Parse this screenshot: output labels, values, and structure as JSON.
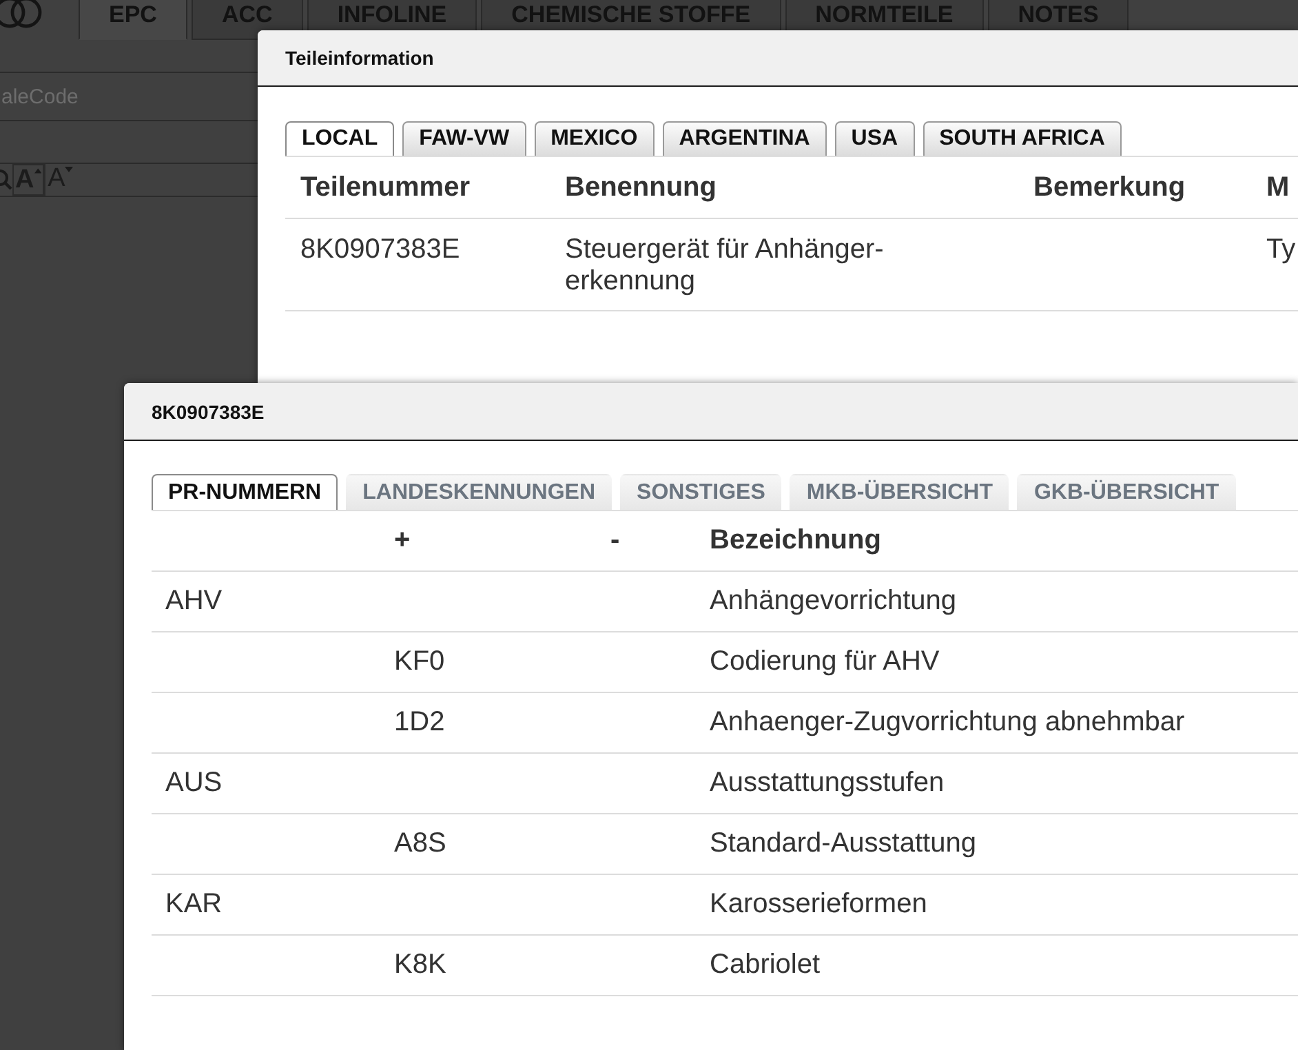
{
  "app_tabs": [
    {
      "label": "EPC",
      "selected": true
    },
    {
      "label": "ACC",
      "selected": false
    },
    {
      "label": "INFOLINE",
      "selected": false
    },
    {
      "label": "CHEMISCHE STOFFE",
      "selected": false
    },
    {
      "label": "NORMTEILE",
      "selected": false
    },
    {
      "label": "NOTES",
      "selected": false
    }
  ],
  "side_panel": {
    "code_field": {
      "placeholder": "aleCode"
    },
    "font_buttons": [
      {
        "kind": "increase",
        "glyph": "A"
      },
      {
        "kind": "decrease",
        "glyph": "A"
      }
    ]
  },
  "parts_dialog": {
    "title": "Teileinformation",
    "tabs": [
      {
        "label": "LOCAL",
        "selected": true
      },
      {
        "label": "FAW-VW",
        "selected": false
      },
      {
        "label": "MEXICO",
        "selected": false
      },
      {
        "label": "ARGENTINA",
        "selected": false
      },
      {
        "label": "USA",
        "selected": false
      },
      {
        "label": "SOUTH AFRICA",
        "selected": false
      }
    ],
    "table": {
      "columns": [
        "Teilenummer",
        "Benennung",
        "Bemerkung",
        "M"
      ],
      "rows": [
        [
          "8K0907383E",
          "Steuergerät für Anhänger-erkennung",
          null,
          "Ty"
        ]
      ]
    }
  },
  "pr_dialog": {
    "title": "8K0907383E",
    "tabs": [
      {
        "label": "PR-NUMMERN",
        "selected": true
      },
      {
        "label": "LANDESKENNUNGEN",
        "selected": false
      },
      {
        "label": "SONSTIGES",
        "selected": false
      },
      {
        "label": "MKB-ÜBERSICHT",
        "selected": false
      },
      {
        "label": "GKB-ÜBERSICHT",
        "selected": false
      }
    ],
    "table": {
      "columns": [
        null,
        "+",
        "-",
        "Bezeichnung"
      ],
      "rows": [
        [
          "AHV",
          null,
          null,
          "Anhängevorrichtung"
        ],
        [
          null,
          "KF0",
          null,
          "Codierung für AHV"
        ],
        [
          null,
          "1D2",
          null,
          "Anhaenger-Zugvorrichtung abnehmbar"
        ],
        [
          "AUS",
          null,
          null,
          "Ausstattungsstufen"
        ],
        [
          null,
          "A8S",
          null,
          "Standard-Ausstattung"
        ],
        [
          "KAR",
          null,
          null,
          "Karosserieformen"
        ],
        [
          null,
          "K8K",
          null,
          "Cabriolet"
        ]
      ]
    }
  }
}
